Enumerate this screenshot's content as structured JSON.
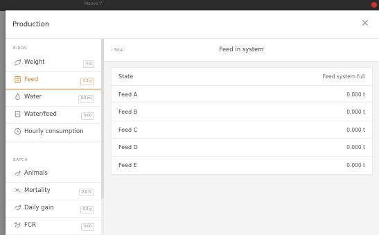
{
  "window": {
    "title": "Moove 7"
  },
  "dialog": {
    "title": "Production",
    "close_symbol": "✕"
  },
  "sidebar": {
    "sections": [
      {
        "label": "BIRDS",
        "items": [
          {
            "label": "Weight",
            "badge": "0 g",
            "icon": "bird-icon",
            "active": false
          },
          {
            "label": "Feed",
            "badge": "0.0 g",
            "icon": "feed-icon",
            "active": true
          },
          {
            "label": "Water",
            "badge": "0.0 ml",
            "icon": "water-drop-icon",
            "active": false
          },
          {
            "label": "Water/feed",
            "badge": "0.00",
            "icon": "water-feed-icon",
            "active": false
          },
          {
            "label": "Hourly consumption",
            "badge": "",
            "icon": "clock-icon",
            "active": false
          }
        ]
      },
      {
        "label": "BATCH",
        "items": [
          {
            "label": "Animals",
            "badge": "",
            "icon": "animals-icon",
            "active": false
          },
          {
            "label": "Mortality",
            "badge": "0.0 %",
            "icon": "mortality-icon",
            "active": false
          },
          {
            "label": "Daily gain",
            "badge": "0.0 g",
            "icon": "daily-gain-icon",
            "active": false
          },
          {
            "label": "FCR",
            "badge": "0.00",
            "icon": "fcr-icon",
            "active": false
          }
        ]
      }
    ]
  },
  "main": {
    "back_label": "‹ Total",
    "title": "Feed in system",
    "table": {
      "header": {
        "name": "State",
        "value": "Feed system full"
      },
      "rows": [
        {
          "name": "Feed A",
          "value": "0.000 t"
        },
        {
          "name": "Feed B",
          "value": "0.000 t"
        },
        {
          "name": "Feed C",
          "value": "0.000 t"
        },
        {
          "name": "Feed D",
          "value": "0.000 t"
        },
        {
          "name": "Feed E",
          "value": "0.000 t"
        }
      ]
    }
  },
  "colors": {
    "accent": "#e8782a",
    "titlebar": "#2c2c2c",
    "alert": "#d0342c"
  }
}
